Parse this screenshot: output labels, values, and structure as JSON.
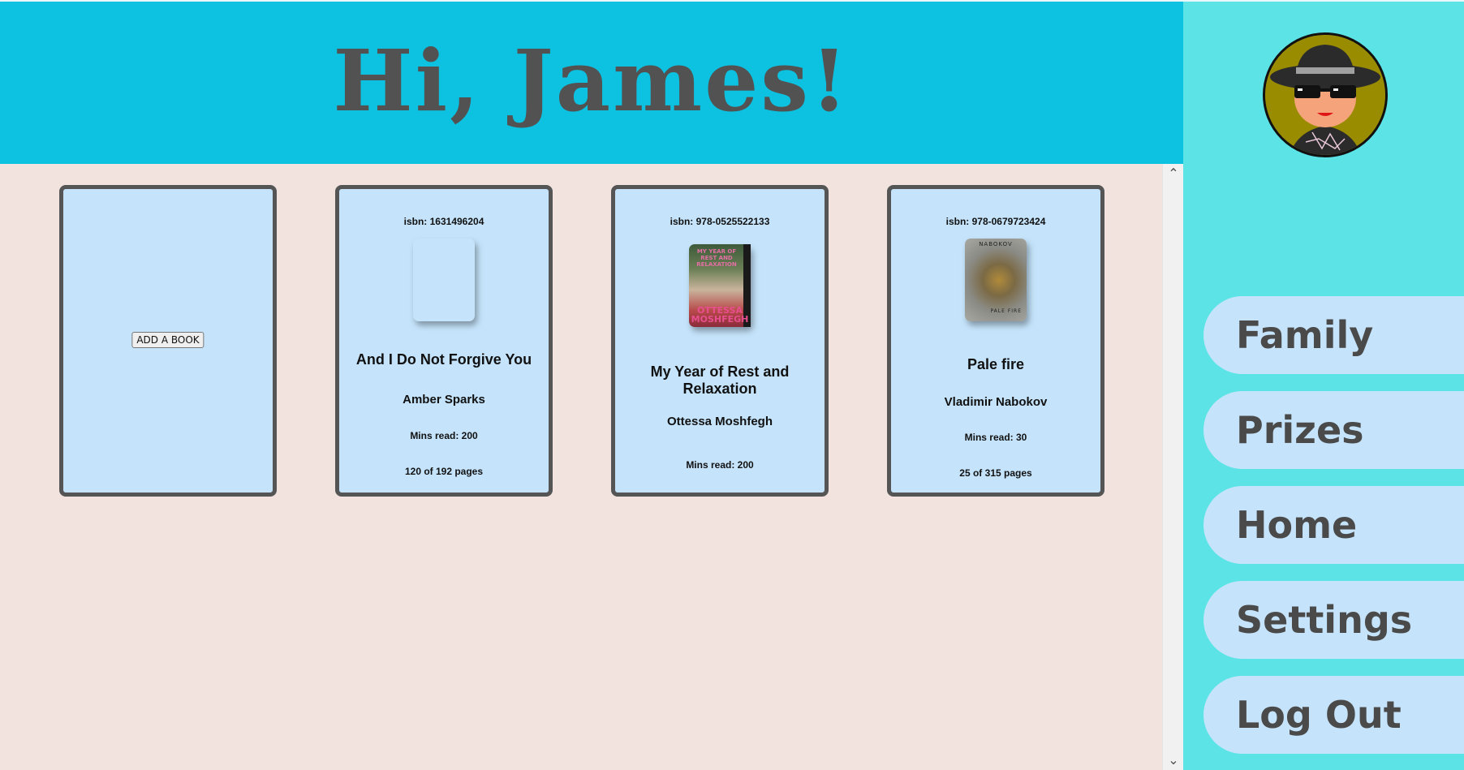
{
  "header": {
    "greeting": "Hi, James!"
  },
  "add_card": {
    "button_label": "ADD A BOOK"
  },
  "books": [
    {
      "isbn": "isbn: 1631496204",
      "cover": "blank",
      "title": "And I Do Not Forgive You",
      "author": "Amber Sparks",
      "mins_read": "Mins read: 200",
      "pages": "120 of 192 pages"
    },
    {
      "isbn": "isbn: 978-0525522133",
      "cover": "book-cover-image",
      "cover_top_text": "MY YEAR OF REST AND RELAXATION",
      "cover_author_text": "OTTESSA MOSHFEGH",
      "title": "My Year of Rest and Relaxation",
      "author": "Ottessa Moshfegh",
      "mins_read": "Mins read: 200",
      "pages": ""
    },
    {
      "isbn": "isbn: 978-0679723424",
      "cover": "book-cover-image",
      "cover_top_text": "NABOKOV",
      "cover_bottom_text": "PALE FIRE",
      "title": "Pale fire",
      "author": "Vladimir Nabokov",
      "mins_read": "Mins read: 30",
      "pages": "25 of 315 pages"
    }
  ],
  "sidebar": {
    "avatar": "spy-avatar-icon",
    "nav": [
      {
        "label": "Family"
      },
      {
        "label": "Prizes"
      },
      {
        "label": "Home"
      },
      {
        "label": "Settings"
      },
      {
        "label": "Log Out"
      }
    ]
  },
  "colors": {
    "header_bg": "#0dc2e1",
    "sidebar_bg": "#5ce3e6",
    "main_bg": "#f2e3df",
    "card_bg": "#c5e4fb",
    "card_border": "#555555",
    "text_dark": "#4a4a4a"
  }
}
